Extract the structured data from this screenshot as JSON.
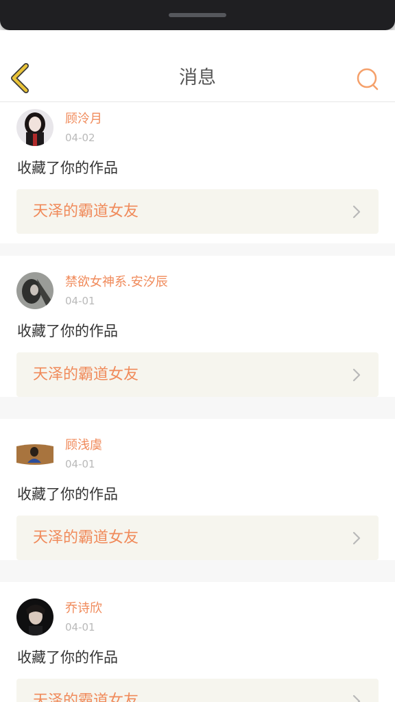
{
  "header": {
    "title": "消息"
  },
  "messages": [
    {
      "username": "顾泠月",
      "date": "04-02",
      "action": "收藏了你的作品",
      "work_title": "天泽的霸道女友"
    },
    {
      "username": "禁欲女神系.安汐辰",
      "date": "04-01",
      "action": "收藏了你的作品",
      "work_title": "天泽的霸道女友"
    },
    {
      "username": "顾浅虞",
      "date": "04-01",
      "action": "收藏了你的作品",
      "work_title": "天泽的霸道女友"
    },
    {
      "username": "乔诗欣",
      "date": "04-01",
      "action": "收藏了你的作品",
      "work_title": "天泽的霸道女友"
    }
  ],
  "colors": {
    "accent": "#f08a5a",
    "back_icon": "#e9c338",
    "search_icon": "#f5a06a"
  },
  "icons": {
    "back": "chevron-left-icon",
    "search": "search-icon",
    "row_arrow": "chevron-right-icon"
  }
}
